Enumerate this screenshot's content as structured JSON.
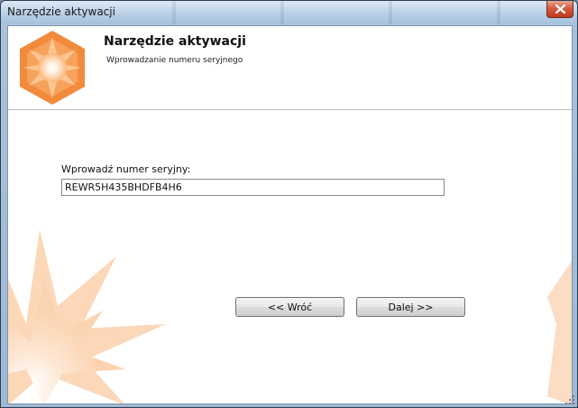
{
  "window": {
    "title": "Narzędzie aktywacji",
    "close_icon": "close-icon"
  },
  "header": {
    "title": "Narzędzie aktywacji",
    "subtitle": "Wprowadzanie numeru seryjnego",
    "logo_icon": "hexagon-star-logo"
  },
  "form": {
    "serial_label": "Wprowadź numer seryjny:",
    "serial_value": "REWR5H435BHDFB4H6"
  },
  "buttons": {
    "back_label": "<< Wróć",
    "next_label": "Dalej >>"
  },
  "colors": {
    "accent_orange": "#f28a3c",
    "accent_light": "#fde0c8"
  }
}
